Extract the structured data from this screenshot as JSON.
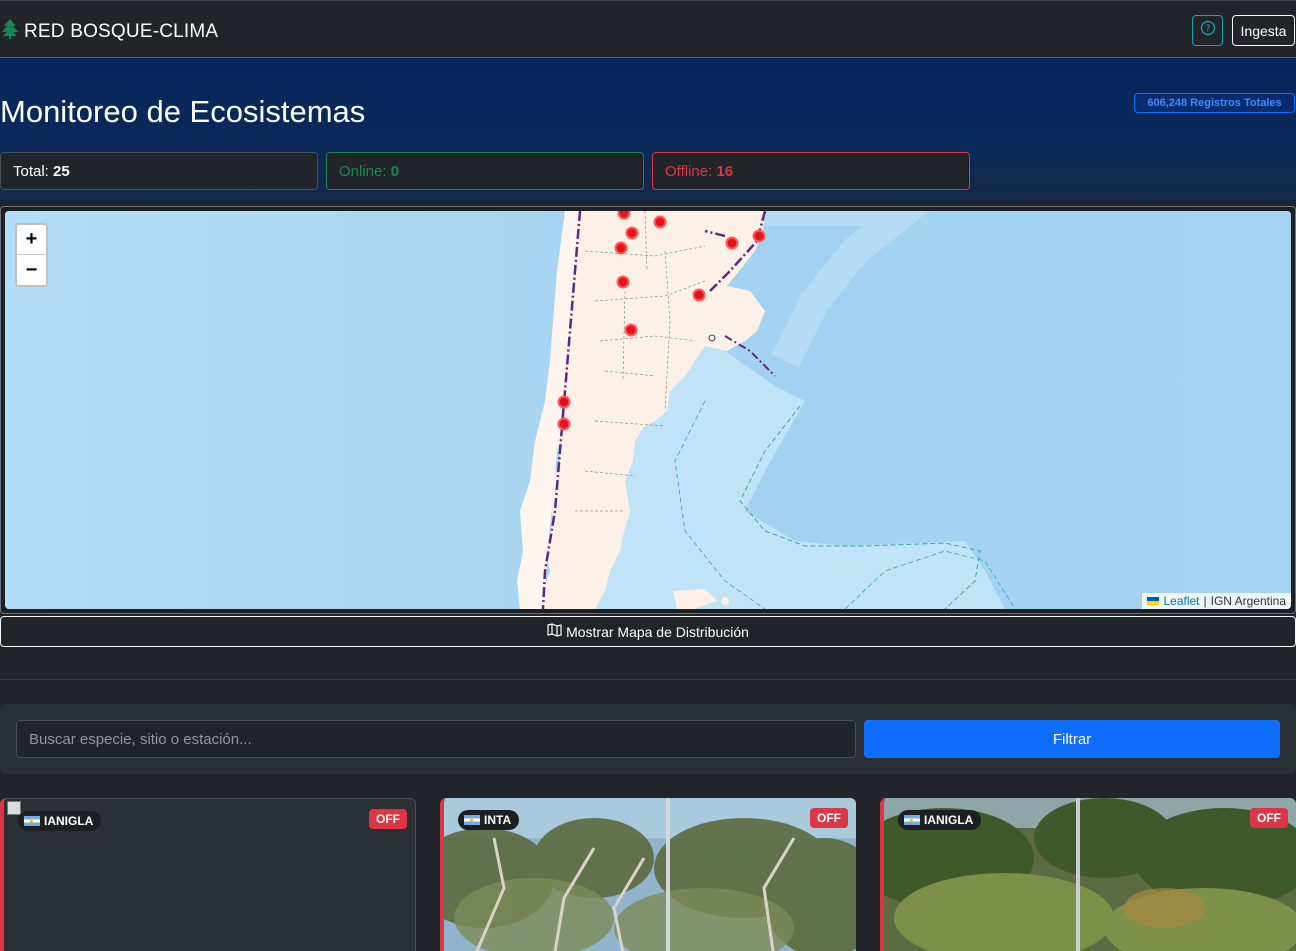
{
  "navbar": {
    "brand": "RED BOSQUE-CLIMA",
    "brand_icon": "tree-icon",
    "help_icon": "question-circle-icon",
    "ingest_label": "Ingesta"
  },
  "hero": {
    "title": "Monitoreo de Ecosistemas",
    "records_badge": "606,248 Registros Totales"
  },
  "stats": {
    "total_label": "Total:",
    "total_value": "25",
    "online_label": "Online:",
    "online_value": "0",
    "offline_label": "Offline:",
    "offline_value": "16"
  },
  "map": {
    "zoom_in": "+",
    "zoom_out": "−",
    "attribution_leaflet": "Leaflet",
    "attribution_sep": "|",
    "attribution_source": "IGN Argentina",
    "marker_color": "#e8121c",
    "toggle_label": "Mostrar Mapa de Distribución",
    "toggle_icon": "map-icon"
  },
  "filter": {
    "search_placeholder": "Buscar especie, sitio o estación...",
    "button_label": "Filtrar"
  },
  "cards": [
    {
      "org": "IANIGLA",
      "status": "OFF"
    },
    {
      "org": "INTA",
      "status": "OFF"
    },
    {
      "org": "IANIGLA",
      "status": "OFF"
    }
  ],
  "colors": {
    "online": "#198754",
    "offline": "#dc3545",
    "primary": "#0d6efd",
    "hero": "#06265e"
  }
}
